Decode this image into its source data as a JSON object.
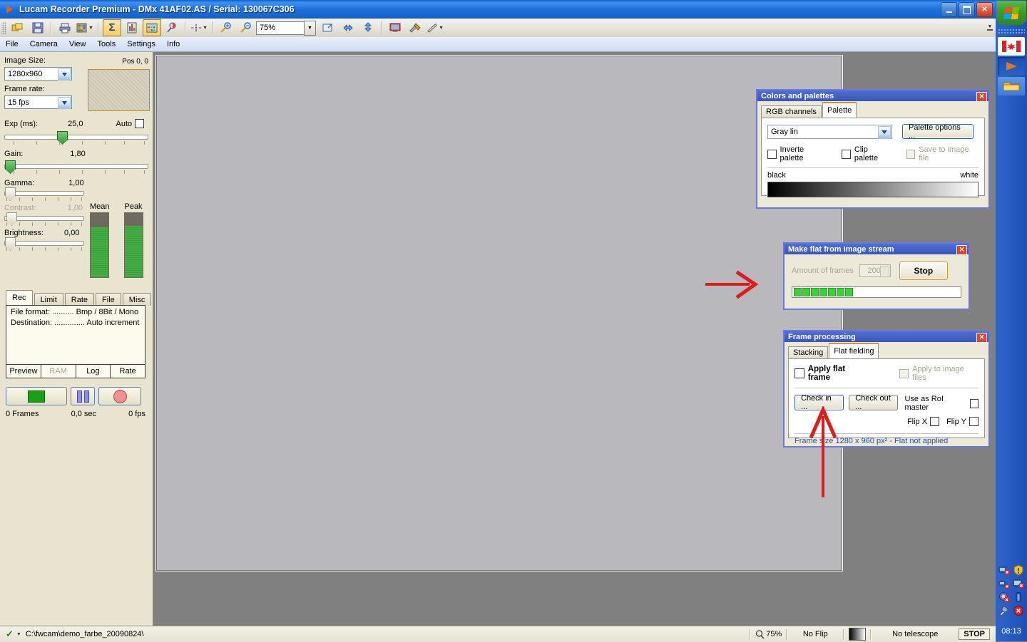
{
  "window": {
    "title": "Lucam Recorder Premium - DMx 41AF02.AS / Serial: 130067C306",
    "minimize_label": "_",
    "maximize_label": "❐",
    "close_label": "✕"
  },
  "toolbar": {
    "zoom_value": "75%",
    "icons": [
      "copy-frames-icon",
      "save-icon",
      "print-icon",
      "color-matrix-icon",
      "sum-sigma-icon",
      "histogram-icon",
      "grid-table-icon",
      "pin-icon",
      "crosshair-icon",
      "zoom-in-icon",
      "zoom-out-icon",
      "fit-window-icon",
      "flip-horizontal-icon",
      "flip-vertical-icon",
      "monitor-icon",
      "tools-icon",
      "telescope-icon"
    ]
  },
  "menu": {
    "items": [
      "File",
      "Camera",
      "View",
      "Tools",
      "Settings",
      "Info"
    ]
  },
  "camera_panel": {
    "image_size_label": "Image Size:",
    "image_size_value": "1280x960",
    "pos_label": "Pos  0, 0",
    "frame_rate_label": "Frame rate:",
    "frame_rate_value": "15 fps",
    "exp_label": "Exp (ms):",
    "exp_value": "25,0",
    "auto_label": "Auto",
    "gain_label": "Gain:",
    "gain_value": "1,80",
    "gamma_label": "Gamma:",
    "gamma_value": "1,00",
    "contrast_label": "Contrast:",
    "contrast_value": "1,00",
    "brightness_label": "Brightness:",
    "brightness_value": "0,00",
    "mean_label": "Mean",
    "peak_label": "Peak",
    "mean_fill_percent": 78,
    "peak_fill_percent": 80
  },
  "rec_panel": {
    "tabs": [
      "Rec",
      "Limit",
      "Rate",
      "File",
      "Misc"
    ],
    "selected_tab": "Rec",
    "info_lines": [
      "File format: .......... Bmp / 8Bit / Mono",
      "Destination: .............. Auto increment"
    ],
    "bottom_tabs": [
      "Preview",
      "RAM",
      "Log",
      "Rate"
    ],
    "disabled_bottom_tab": "RAM",
    "buttons": [
      "preview-start-button",
      "pause-button",
      "record-button"
    ],
    "stats": {
      "frames": "0 Frames",
      "seconds": "0,0 sec",
      "fps": "0 fps"
    }
  },
  "colors_dialog": {
    "title": "Colors and palettes",
    "tabs": [
      "RGB channels",
      "Palette"
    ],
    "selected_tab": "Palette",
    "palette_value": "Gray lin",
    "palette_options_button": "Palette options ...",
    "checkboxes": [
      {
        "label": "Inverte palette",
        "checked": false,
        "disabled": false
      },
      {
        "label": "Clip palette",
        "checked": false,
        "disabled": false
      },
      {
        "label": "Save to image file",
        "checked": false,
        "disabled": true
      }
    ],
    "gradient_left_label": "black",
    "gradient_right_label": "white"
  },
  "flat_dialog": {
    "title": "Make flat from image stream",
    "amount_label": "Amount of frames",
    "amount_value": "200",
    "stop_button": "Stop",
    "progress_blocks": 7
  },
  "frame_processing": {
    "title": "Frame processing",
    "tabs": [
      "Stacking",
      "Flat fielding"
    ],
    "selected_tab": "Flat fielding",
    "apply_flat_frame_label": "Apply flat frame",
    "apply_flat_frame_checked": false,
    "apply_to_image_files_label": "Apply to image files",
    "apply_to_image_files_disabled": true,
    "check_in_button": "Check in ...",
    "check_out_button": "Check out ...",
    "roi_master_label": "Use as RoI master",
    "flip_x_label": "Flip X",
    "flip_y_label": "Flip Y",
    "status_text": "Frame size 1280 x 960 px² - Flat not applied"
  },
  "statusbar": {
    "path": "C:\\fwcam\\demo_farbe_20090824\\",
    "zoom": "75%",
    "flip": "No Flip",
    "telescope": "No telescope",
    "stop": "STOP"
  },
  "taskbar": {
    "start_label": "start",
    "clock": "08:13",
    "items": [
      "canada-flag-app-icon",
      "lucam-recorder-icon",
      "folder-window-icon"
    ],
    "tray_icons": [
      "network-disconnect-icon",
      "security-alert-icon",
      "wireless-off-icon",
      "monitor-error-icon",
      "sound-mute-icon",
      "battery-icon",
      "settings-wrench-icon",
      "shield-error-icon"
    ]
  },
  "annotations": {
    "arrow_to_stop": "arrow-pointing-to-make-flat-dialog",
    "arrow_to_check_in": "arrow-pointing-to-check-in-button"
  },
  "colors": {
    "accent_blue": "#2a5fc6",
    "panel_beige": "#e8e4d0",
    "dialog_border": "#6b78d4",
    "annotation_red": "#e01b1b",
    "meter_green": "#3a9c3a"
  }
}
